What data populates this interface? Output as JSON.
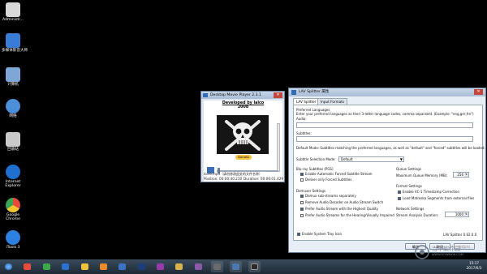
{
  "desktop": {
    "icons": [
      {
        "label": "Administr...",
        "color": "#d8d8d8"
      },
      {
        "label": "多媒体影音大师",
        "color": "#3a7bd5"
      },
      {
        "label": "计算机",
        "color": "#7ea7d8"
      },
      {
        "label": "网络",
        "color": "#4a8fd8"
      },
      {
        "label": "回收站",
        "color": "#c9c9c9"
      },
      {
        "label": "Internet Explorer",
        "color": "#1f6fd1"
      },
      {
        "label": "Google Chrome",
        "color": "#e84b3c"
      },
      {
        "label": "iTools 3",
        "color": "#2d7fe0"
      }
    ]
  },
  "dmp": {
    "title": "Desktop Movie Player 2.3.1",
    "developed_by": "Developed by lalco",
    "year": "2008",
    "donate_label": "Donate",
    "filename": "lcore.mp4",
    "filename_tail": "（请勿修改此处的文件名称）",
    "position": "Position: 00:00:40.210",
    "duration": "Duration: 00:06:01.429"
  },
  "lav": {
    "title": "LAV Splitter 属性",
    "tabs": [
      "LAV Splitter",
      "Input Formats"
    ],
    "preferred_languages": "Preferred Languages",
    "pref_desc": "Enter your preferred languages as their 3-letter language codes, comma separated. (Example: \"eng,ger,fre\")",
    "audio_label": "Audio:",
    "subtitles_label": "Subtitles:",
    "default_mode_desc": "Default Mode: Subtitles matching the preferred languages, as well as \"default\" and \"forced\" subtitles will be loaded.",
    "subtitle_mode_label": "Subtitle Selection Mode:",
    "subtitle_mode_value": "Default",
    "bluray_title": "Blu-ray Subtitles (PGS)",
    "bluray_opts": [
      {
        "label": "Enable Automatic Forced Subtitle Stream",
        "checked": true
      },
      {
        "label": "Deliver only Forced Subtitles",
        "checked": false
      }
    ],
    "demuxer_title": "Demuxer Settings",
    "demuxer_opts": [
      {
        "label": "Demux sub-streams separately",
        "checked": true
      },
      {
        "label": "Remove Audio Decoder on Audio Stream Switch",
        "checked": false
      },
      {
        "label": "Prefer Audio Stream with the Highest Quality",
        "checked": true
      },
      {
        "label": "Prefer Audio Streams for the Hearing/Visually Impaired",
        "checked": false
      }
    ],
    "queue_title": "Queue Settings",
    "max_queue_label": "Maximum Queue Memory (MB):",
    "max_queue_value": "256",
    "format_title": "Format Settings",
    "format_opts": [
      {
        "label": "Enable VC-1 Timestamp Correction",
        "checked": true
      },
      {
        "label": "Load Matroska Segments from external files",
        "checked": true
      }
    ],
    "network_title": "Network Settings",
    "stream_analysis_label": "Stream Analysis Duration:",
    "stream_analysis_value": "1000",
    "tray_label": "Enable System Tray Icon",
    "version": "LAV Splitter 0.62.0.0",
    "buttons": [
      "确定",
      "取消",
      "应用(A)"
    ]
  },
  "taskbar": {
    "icons": [
      {
        "name": "start-orb-icon",
        "color": "#3a8ee6"
      },
      {
        "name": "chrome-icon",
        "color": "#e84b3c"
      },
      {
        "name": "green-app-icon",
        "color": "#3da84a"
      },
      {
        "name": "ie-icon",
        "color": "#2b6fcf"
      },
      {
        "name": "qq-icon",
        "color": "#f0c43a"
      },
      {
        "name": "orange-app-icon",
        "color": "#e98a2c"
      },
      {
        "name": "blue-app-icon",
        "color": "#3b73c4"
      },
      {
        "name": "media-app-icon",
        "color": "#9a3aa8"
      },
      {
        "name": "photoshop-icon",
        "color": "#1b3d7a"
      },
      {
        "name": "folder-icon",
        "color": "#d8b24a"
      },
      {
        "name": "rar-icon",
        "color": "#8a5aa6"
      },
      {
        "name": "gear-app-icon",
        "color": "#6a6a6a"
      },
      {
        "name": "player-app-icon",
        "color": "#4a78b0"
      },
      {
        "name": "dmp-app-icon",
        "color": "#2a2a2a"
      }
    ],
    "time": "15:17",
    "date": "2017/6/3"
  },
  "watermark": {
    "text": "当下软件园",
    "sub": "WWW.DOWNXIA.COM"
  }
}
